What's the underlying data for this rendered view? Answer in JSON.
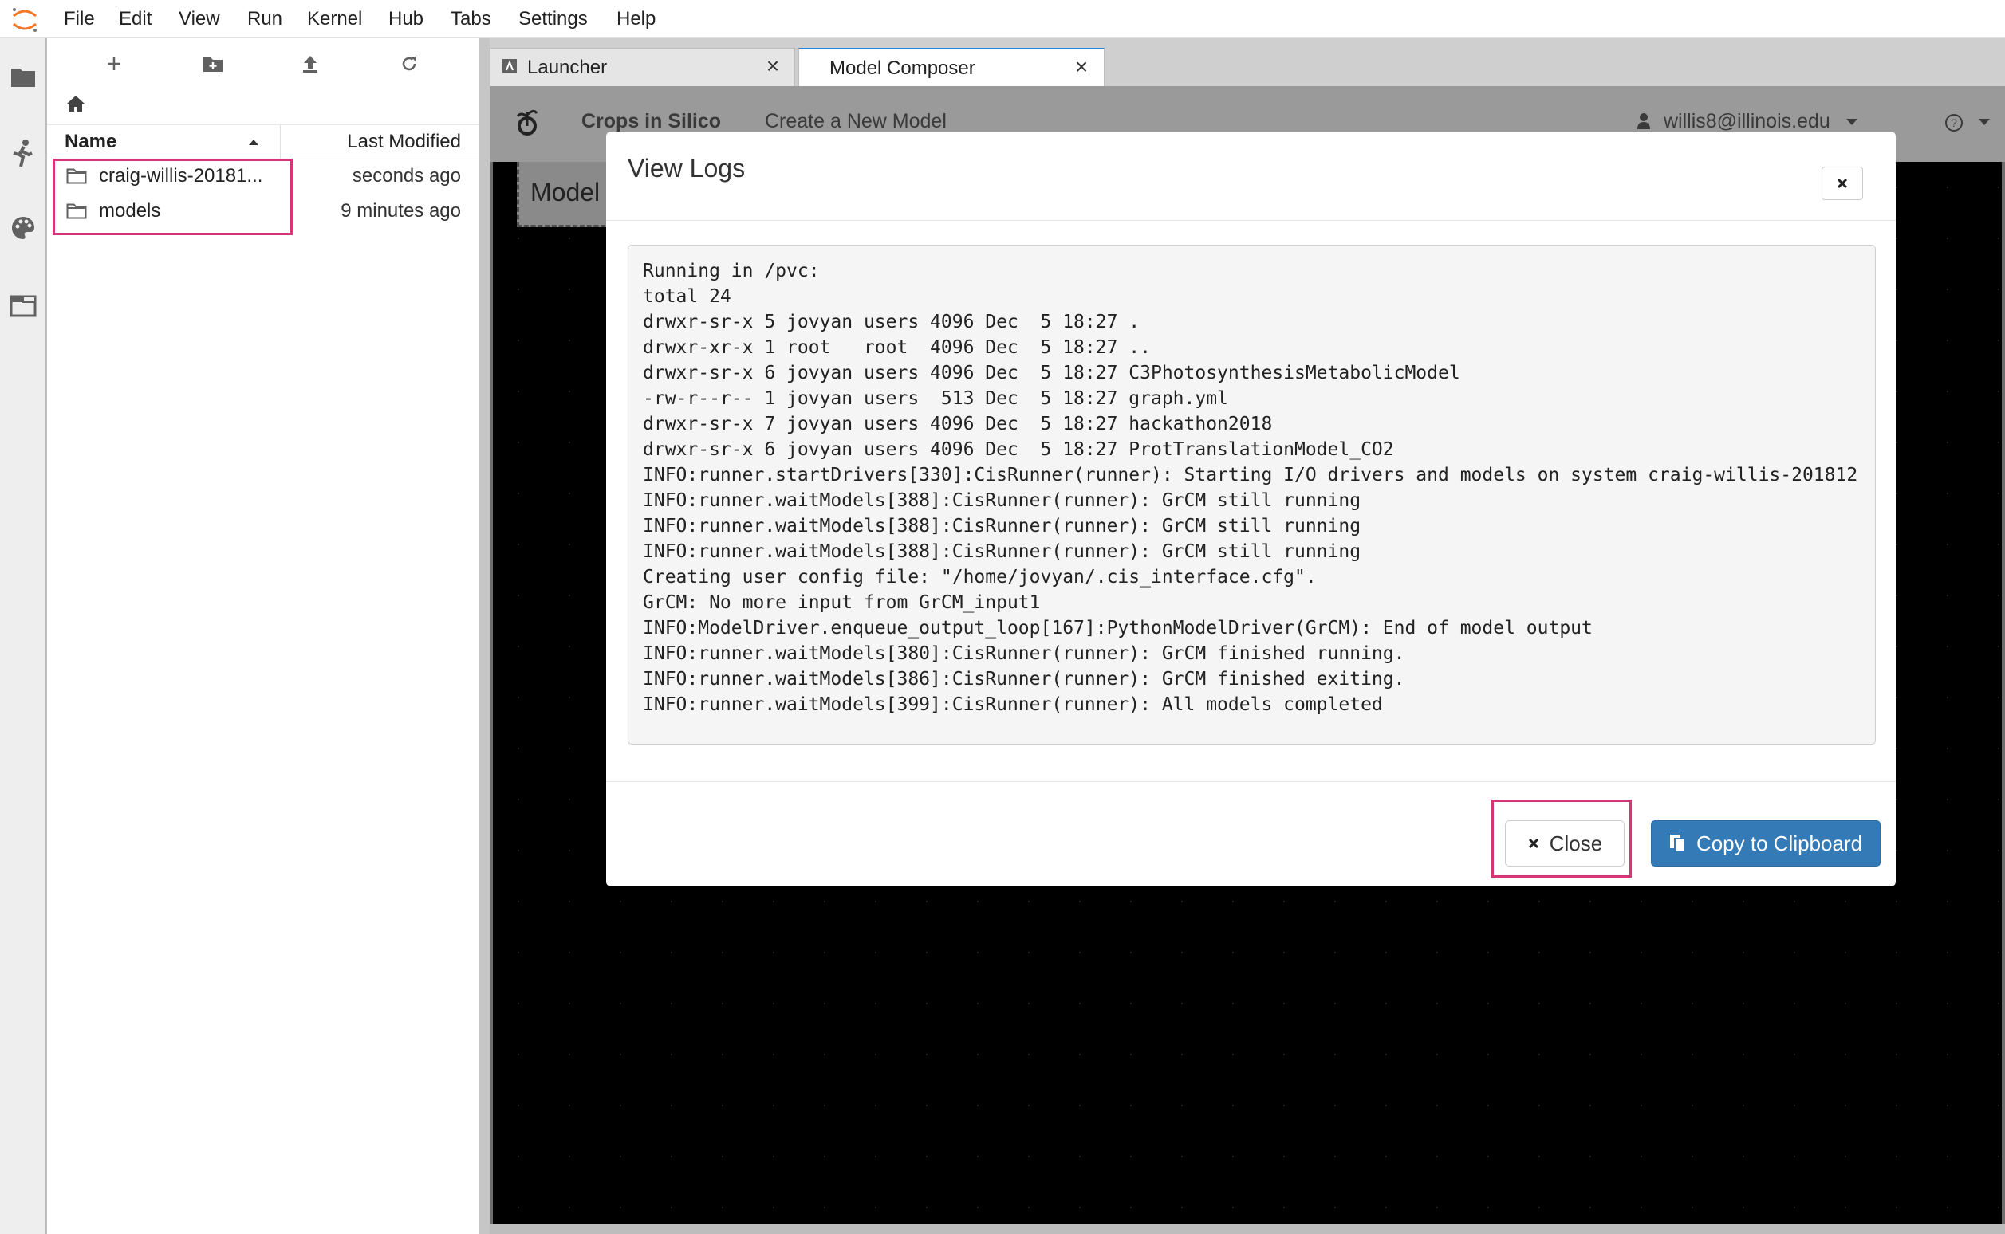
{
  "menubar": {
    "items": [
      "File",
      "Edit",
      "View",
      "Run",
      "Kernel",
      "Hub",
      "Tabs",
      "Settings",
      "Help"
    ]
  },
  "filebrowser": {
    "columns": {
      "name": "Name",
      "modified": "Last Modified"
    },
    "rows": [
      {
        "name": "craig-willis-20181...",
        "modified": "seconds ago"
      },
      {
        "name": "models",
        "modified": "9 minutes ago"
      }
    ]
  },
  "tabs": [
    {
      "label": "Launcher",
      "active": false
    },
    {
      "label": "Model Composer",
      "active": true
    }
  ],
  "app": {
    "brand": "Crops in Silico",
    "nav_link": "Create a New Model",
    "user": "willis8@illinois.edu",
    "model_button_stub": "Model"
  },
  "modal": {
    "title": "View Logs",
    "log": "Running in /pvc:\ntotal 24\ndrwxr-sr-x 5 jovyan users 4096 Dec  5 18:27 .\ndrwxr-xr-x 1 root   root  4096 Dec  5 18:27 ..\ndrwxr-sr-x 6 jovyan users 4096 Dec  5 18:27 C3PhotosynthesisMetabolicModel\n-rw-r--r-- 1 jovyan users  513 Dec  5 18:27 graph.yml\ndrwxr-sr-x 7 jovyan users 4096 Dec  5 18:27 hackathon2018\ndrwxr-sr-x 6 jovyan users 4096 Dec  5 18:27 ProtTranslationModel_CO2\nINFO:runner.startDrivers[330]:CisRunner(runner): Starting I/O drivers and models on system craig-willis-201812\nINFO:runner.waitModels[388]:CisRunner(runner): GrCM still running\nINFO:runner.waitModels[388]:CisRunner(runner): GrCM still running\nINFO:runner.waitModels[388]:CisRunner(runner): GrCM still running\nCreating user config file: \"/home/jovyan/.cis_interface.cfg\".\nGrCM: No more input from GrCM_input1\nINFO:ModelDriver.enqueue_output_loop[167]:PythonModelDriver(GrCM): End of model output\nINFO:runner.waitModels[380]:CisRunner(runner): GrCM finished running.\nINFO:runner.waitModels[386]:CisRunner(runner): GrCM finished exiting.\nINFO:runner.waitModels[399]:CisRunner(runner): All models completed",
    "close_label": "Close",
    "copy_label": "Copy to Clipboard"
  },
  "colors": {
    "accent_highlight": "#d6357a",
    "primary_button": "#337ab7",
    "jupyter_orange": "#f37726"
  }
}
